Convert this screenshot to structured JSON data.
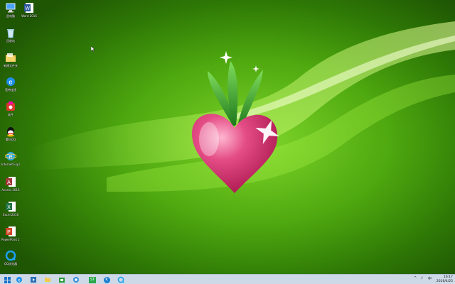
{
  "desktop": {
    "icons": [
      {
        "label": "此电脑",
        "icon": "computer-icon"
      },
      {
        "label": "Word 2016",
        "icon": "word-icon"
      },
      {
        "label": "回收站",
        "icon": "recycle-bin-icon"
      },
      {
        "label": "新建文件夹",
        "icon": "folder-icon"
      },
      {
        "label": "宽带连接",
        "icon": "ie-icon"
      },
      {
        "label": "软件",
        "icon": "software-icon"
      },
      {
        "label": "腾讯QQ",
        "icon": "qq-icon"
      },
      {
        "label": "Internet Explorer",
        "icon": "ie2-icon"
      },
      {
        "label": "Access 2016",
        "icon": "access-icon"
      },
      {
        "label": "Excel 2016",
        "icon": "excel-icon"
      },
      {
        "label": "PowerPoint 2016",
        "icon": "powerpoint-icon"
      },
      {
        "label": "QQ浏览器",
        "icon": "qq-browser-icon"
      }
    ]
  },
  "taskbar": {
    "buttons": [
      "start-button",
      "ie-taskbar",
      "media-taskbar",
      "explorer-taskbar",
      "store-taskbar",
      "network-taskbar",
      "app-taskbar",
      "k-app-taskbar",
      "browser-taskbar"
    ],
    "app_label": "ST",
    "k_label": "K",
    "tray_labels": [
      "^",
      "♪",
      "中"
    ],
    "clock_time": "16:17",
    "clock_date": "2016/4/25"
  },
  "colors": {
    "wallpaper_green": "#4ea80f",
    "taskbar": "#cdd9e6",
    "radish_pink": "#d8336f",
    "leaf_green": "#2e9a2a"
  }
}
